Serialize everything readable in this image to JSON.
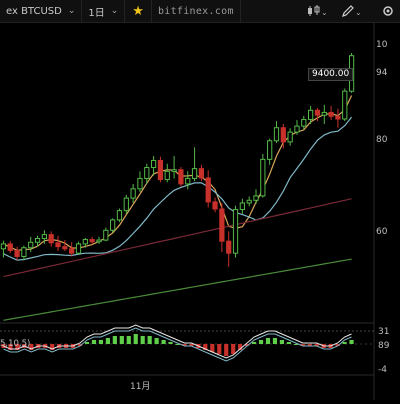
{
  "toolbar": {
    "symbol": "ex BTCUSD",
    "interval": "1日",
    "site": "bitfinex.com",
    "colors": {
      "background": "#101010",
      "star": "#f0c419"
    },
    "icons": [
      "chevron-down-icon",
      "star-icon",
      "candle-type-icon",
      "pencil-icon",
      "settings-icon"
    ]
  },
  "price_axis": {
    "ticks": [
      "10",
      "94",
      "80",
      "60"
    ],
    "last_price_label": "9400.00"
  },
  "indicator": {
    "params": "5,10,5)",
    "axis_ticks": [
      "31",
      "89",
      "-4"
    ]
  },
  "time_axis": {
    "labels": [
      "11月"
    ]
  },
  "chart_data": {
    "type": "candlestick",
    "colors": {
      "up": "#54b948",
      "down": "#c8302b",
      "ma_fast": "#d9a55b",
      "ma_mid": "#7fb8c8",
      "ma_slow": "#7a2a35",
      "ma_long": "#4a8a3a"
    },
    "grid": false,
    "candles": [
      {
        "o": 5860,
        "h": 6010,
        "l": 5700,
        "c": 5950
      },
      {
        "o": 5950,
        "h": 6000,
        "l": 5780,
        "c": 5830
      },
      {
        "o": 5830,
        "h": 5900,
        "l": 5650,
        "c": 5720
      },
      {
        "o": 5720,
        "h": 5920,
        "l": 5650,
        "c": 5880
      },
      {
        "o": 5880,
        "h": 6080,
        "l": 5800,
        "c": 5980
      },
      {
        "o": 5980,
        "h": 6100,
        "l": 5900,
        "c": 6050
      },
      {
        "o": 6050,
        "h": 6200,
        "l": 5950,
        "c": 6120
      },
      {
        "o": 6120,
        "h": 6180,
        "l": 5900,
        "c": 5970
      },
      {
        "o": 5970,
        "h": 6100,
        "l": 5820,
        "c": 5900
      },
      {
        "o": 5900,
        "h": 6020,
        "l": 5820,
        "c": 5860
      },
      {
        "o": 5860,
        "h": 5980,
        "l": 5720,
        "c": 5780
      },
      {
        "o": 5780,
        "h": 5990,
        "l": 5750,
        "c": 5950
      },
      {
        "o": 5950,
        "h": 6060,
        "l": 5880,
        "c": 6030
      },
      {
        "o": 6030,
        "h": 6080,
        "l": 5940,
        "c": 5990
      },
      {
        "o": 5990,
        "h": 6080,
        "l": 5950,
        "c": 6020
      },
      {
        "o": 6020,
        "h": 6250,
        "l": 6000,
        "c": 6200
      },
      {
        "o": 6200,
        "h": 6420,
        "l": 6160,
        "c": 6390
      },
      {
        "o": 6390,
        "h": 6600,
        "l": 6350,
        "c": 6560
      },
      {
        "o": 6560,
        "h": 6850,
        "l": 6500,
        "c": 6790
      },
      {
        "o": 6790,
        "h": 7050,
        "l": 6700,
        "c": 6960
      },
      {
        "o": 6960,
        "h": 7280,
        "l": 6900,
        "c": 7150
      },
      {
        "o": 7150,
        "h": 7420,
        "l": 7050,
        "c": 7350
      },
      {
        "o": 7350,
        "h": 7560,
        "l": 7200,
        "c": 7480
      },
      {
        "o": 7480,
        "h": 7550,
        "l": 7080,
        "c": 7130
      },
      {
        "o": 7130,
        "h": 7420,
        "l": 7080,
        "c": 7280
      },
      {
        "o": 7280,
        "h": 7560,
        "l": 7150,
        "c": 7310
      },
      {
        "o": 7310,
        "h": 7360,
        "l": 7000,
        "c": 7050
      },
      {
        "o": 7050,
        "h": 7280,
        "l": 6950,
        "c": 7150
      },
      {
        "o": 7150,
        "h": 7720,
        "l": 7100,
        "c": 7330
      },
      {
        "o": 7330,
        "h": 7400,
        "l": 7100,
        "c": 7160
      },
      {
        "o": 7160,
        "h": 7300,
        "l": 6620,
        "c": 6720
      },
      {
        "o": 6720,
        "h": 6800,
        "l": 6530,
        "c": 6590
      },
      {
        "o": 6590,
        "h": 6700,
        "l": 5800,
        "c": 6000
      },
      {
        "o": 6000,
        "h": 6180,
        "l": 5530,
        "c": 5780
      },
      {
        "o": 5780,
        "h": 6650,
        "l": 5700,
        "c": 6580
      },
      {
        "o": 6580,
        "h": 6780,
        "l": 6500,
        "c": 6700
      },
      {
        "o": 6700,
        "h": 6820,
        "l": 6640,
        "c": 6750
      },
      {
        "o": 6750,
        "h": 6950,
        "l": 6680,
        "c": 6830
      },
      {
        "o": 6830,
        "h": 7600,
        "l": 6800,
        "c": 7500
      },
      {
        "o": 7500,
        "h": 7880,
        "l": 7400,
        "c": 7840
      },
      {
        "o": 7840,
        "h": 8200,
        "l": 7800,
        "c": 8080
      },
      {
        "o": 8080,
        "h": 8150,
        "l": 7700,
        "c": 7820
      },
      {
        "o": 7820,
        "h": 8070,
        "l": 7750,
        "c": 8000
      },
      {
        "o": 8000,
        "h": 8220,
        "l": 7950,
        "c": 8110
      },
      {
        "o": 8110,
        "h": 8300,
        "l": 8050,
        "c": 8230
      },
      {
        "o": 8230,
        "h": 8480,
        "l": 8150,
        "c": 8400
      },
      {
        "o": 8400,
        "h": 8440,
        "l": 8200,
        "c": 8310
      },
      {
        "o": 8310,
        "h": 8500,
        "l": 8150,
        "c": 8360
      },
      {
        "o": 8360,
        "h": 8480,
        "l": 8220,
        "c": 8290
      },
      {
        "o": 8290,
        "h": 8430,
        "l": 8080,
        "c": 8240
      },
      {
        "o": 8240,
        "h": 8800,
        "l": 8200,
        "c": 8750
      },
      {
        "o": 8750,
        "h": 9450,
        "l": 8720,
        "c": 9400
      }
    ],
    "ylim": [
      4500,
      10000
    ],
    "indicator_histogram": [
      -2,
      -3,
      -3,
      -2,
      -3,
      -2,
      -2,
      -3,
      -2,
      -2,
      -2,
      -1,
      1,
      2,
      2,
      3,
      4,
      4,
      4,
      5,
      4,
      4,
      3,
      2,
      1,
      0,
      -1,
      -1,
      -2,
      -3,
      -4,
      -5,
      -6,
      -5,
      -3,
      -1,
      1,
      2,
      3,
      3,
      2,
      1,
      0,
      -1,
      -1,
      -1,
      -2,
      -2,
      -1,
      1,
      2
    ]
  }
}
